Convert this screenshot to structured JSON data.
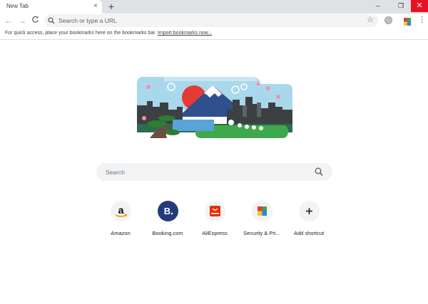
{
  "browser": {
    "tab_title": "New Tab",
    "tab_close": "×",
    "new_tab_symbol": "+",
    "window_minimize": "–",
    "window_maximize": "❐",
    "window_close": "✕"
  },
  "toolbar": {
    "back_symbol": "←",
    "forward_symbol": "→",
    "reload_symbol": "C",
    "omnibox_placeholder": "Search or type a URL",
    "star_symbol": "☆",
    "menu_symbol": "⋮"
  },
  "bookmarks_bar": {
    "message": "For quick access, place your bookmarks here on the bookmarks bar. ",
    "import_link": "Import bookmarks now..."
  },
  "ntp": {
    "search_placeholder": "Search",
    "shortcuts": [
      {
        "label": "Amazon",
        "icon": "amazon-icon"
      },
      {
        "label": "Booking.com",
        "icon": "booking-icon"
      },
      {
        "label": "AliExpress",
        "icon": "aliexpress-icon"
      },
      {
        "label": "Security & Pri...",
        "icon": "security-icon"
      },
      {
        "label": "Add shortcut",
        "icon": "plus-icon"
      }
    ]
  },
  "colors": {
    "titlebar": "#dee1e6",
    "close_red": "#e81123",
    "booking_blue": "#243b7a",
    "aliexpress_red": "#e62e04"
  }
}
